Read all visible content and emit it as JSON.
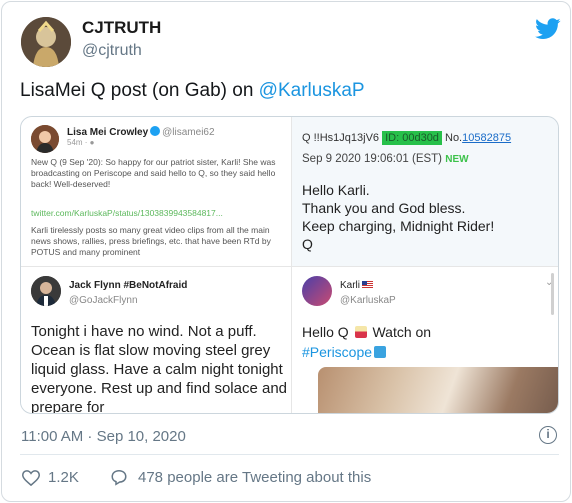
{
  "author": {
    "name": "CJTRUTH",
    "handle": "@cjtruth"
  },
  "tweet": {
    "text": "LisaMei Q post (on Gab) on ",
    "mention": "@KarluskaP"
  },
  "media": {
    "lisa": {
      "name": "Lisa Mei Crowley",
      "handle": "@lisamei62",
      "time": "54m · ",
      "body": "New Q (9 Sep '20): So happy for our patriot sister, Karli! She was broadcasting on Periscope and said hello to Q, so they said hello back! Well-deserved!",
      "link": "twitter.com/KarluskaP/status/1303839943584817...",
      "body2": "Karli tirelessly posts so many great video clips from all the main news shows, rallies, press briefings, etc. that have been RTd by POTUS and many prominent"
    },
    "qpost": {
      "prefix": "Q !!Hs1Jq13jV6",
      "id": "ID: 00d30d",
      "no_label": "No.",
      "no_value": "10582875",
      "date": "Sep 9 2020 19:06:01 (EST)",
      "new_label": "NEW",
      "lines": [
        "Hello Karli.",
        "Thank you and God bless.",
        "Keep charging, Midnight Rider!",
        "Q"
      ]
    },
    "jack": {
      "name": "Jack Flynn #BeNotAfraid",
      "handle": "@GoJackFlynn",
      "body": "Tonight i have no wind. Not a puff. Ocean is flat slow moving steel grey liquid glass. Have a calm night tonight everyone. Rest up and find solace and prepare for"
    },
    "karli": {
      "name": "Karli",
      "handle": "@KarluskaP",
      "text1": "Hello Q ",
      "text2": " Watch on",
      "hashtag": "#Periscope",
      "chevron": "⌄"
    }
  },
  "meta": {
    "timestamp": "11:00 AM · Sep 10, 2020",
    "info_icon": "i"
  },
  "actions": {
    "likes": "1.2K",
    "replies_text": "478 people are Tweeting about this"
  },
  "icons": [
    "twitter-bird-icon",
    "info-icon",
    "heart-icon",
    "reply-icon",
    "verified-icon",
    "flag-icon"
  ],
  "colors": {
    "link": "#1b95e0",
    "bird": "#1da1f2",
    "muted": "#657786"
  }
}
